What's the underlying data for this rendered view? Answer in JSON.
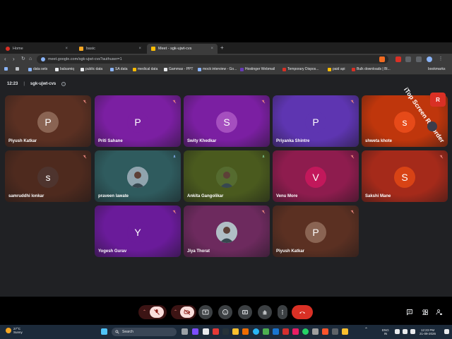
{
  "browser": {
    "tabs": [
      {
        "title": "Home",
        "color": "#d93025"
      },
      {
        "title": "basic",
        "color": "#f5a623"
      },
      {
        "title": "Meet - sgk-ujwt-cvs",
        "color": "#fbbc04"
      }
    ],
    "new_tab": "+",
    "address": "meet.google.com/sgk-ujwt-cvs?authuser=1",
    "bookmarks": [
      {
        "label": "data sets",
        "color": "#8ab4f8"
      },
      {
        "label": "balsamiq",
        "color": "#e8eaed"
      },
      {
        "label": "public data",
        "color": "#e8eaed"
      },
      {
        "label": "SA data",
        "color": "#8ab4f8"
      },
      {
        "label": "medical data",
        "color": "#fbbc04"
      },
      {
        "label": "Gammas - PPT",
        "color": "#e8eaed"
      },
      {
        "label": "mock interview - Go...",
        "color": "#8ab4f8"
      },
      {
        "label": "Hostinger Webmail",
        "color": "#673ab7"
      },
      {
        "label": "Temporary Dispos...",
        "color": "#d93025"
      },
      {
        "label": "paid api",
        "color": "#fbbc04"
      },
      {
        "label": "Bulk downloads | Bl...",
        "color": "#d93025"
      },
      {
        "label": "bookmarks",
        "color": "#e8eaed"
      }
    ]
  },
  "meeting": {
    "time": "12:23",
    "separator": "|",
    "code": "sgk-ujwt-cvs",
    "info_icon": "i"
  },
  "participants": [
    {
      "name": "Piyush Katkar",
      "initial": "P",
      "bg": "#5b3022",
      "avatar": "#8a6453",
      "mic": "muted"
    },
    {
      "name": "Priti Sahane",
      "initial": "P",
      "bg": "#7b1fa2",
      "avatar": "#7b1fa2",
      "mic": "muted"
    },
    {
      "name": "Swity Khedkar",
      "initial": "S",
      "bg": "#7b1fa2",
      "avatar": "#a54fbf",
      "mic": "muted"
    },
    {
      "name": "Priyanka Shintre",
      "initial": "P",
      "bg": "#5e35b1",
      "avatar": "#5e35b1",
      "mic": "muted"
    },
    {
      "name": "shweta khote",
      "initial": "s",
      "bg": "#bf360c",
      "avatar": "#e64a19",
      "mic": "muted"
    },
    {
      "name": "samruddhi lonkar",
      "initial": "s",
      "bg": "#4e2a1e",
      "avatar": "#4e342e",
      "mic": "muted"
    },
    {
      "name": "praveen lawate",
      "initial": "",
      "bg": "#2f5b5e",
      "avatar": "#90a4ae",
      "mic": "active-blue"
    },
    {
      "name": "Ankita Gangolikar",
      "initial": "",
      "bg": "#4a5a1e",
      "avatar": "#556b2f",
      "mic": "active-green"
    },
    {
      "name": "Venu More",
      "initial": "V",
      "bg": "#8e1c4e",
      "avatar": "#c2185b",
      "mic": "muted"
    },
    {
      "name": "Sakshi Mane",
      "initial": "S",
      "bg": "#a52a1a",
      "avatar": "#d84315",
      "mic": "muted"
    },
    {
      "name": "Yogesh Gurav",
      "initial": "Y",
      "bg": "#6a1b9a",
      "avatar": "#6a1b9a",
      "mic": "muted"
    },
    {
      "name": "Jiya Thorat",
      "initial": "",
      "bg": "#6d2a5e",
      "avatar": "#b0bec5",
      "mic": "muted"
    },
    {
      "name": "Piyush Katkar",
      "initial": "P",
      "bg": "#5b3022",
      "avatar": "#8a6453",
      "mic": "muted"
    }
  ],
  "controls": {
    "end_call_color": "#d93025",
    "muted_bg": "#3c1414"
  },
  "recorder": {
    "text": "iTop Screen Recorder",
    "badge": "R"
  },
  "taskbar": {
    "weather_temp": "27°C",
    "weather_desc": "Sunny",
    "search_placeholder": "Search",
    "lang_top": "ENG",
    "lang_bottom": "IN",
    "clock_time": "12:23 PM",
    "clock_date": "21-09-2026"
  }
}
